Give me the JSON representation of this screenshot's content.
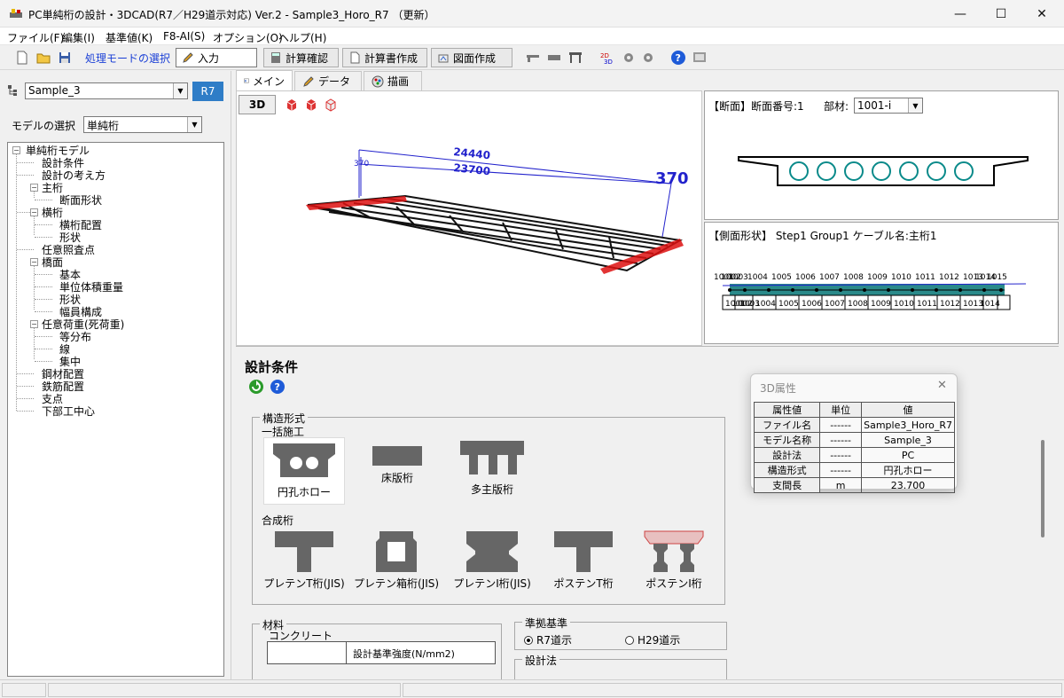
{
  "window": {
    "title": "PC単純桁の設計・3DCAD(R7／H29道示対応) Ver.2 - Sample3_Horo_R7 （更新）",
    "minimize": "—",
    "maximize": "☐",
    "close": "✕"
  },
  "menu": [
    "ファイル(F)",
    "編集(I)",
    "基準値(K)",
    "F8-AI(S)",
    "オプション(O)",
    "ヘルプ(H)"
  ],
  "toolbar": {
    "mode_label": "処理モードの選択",
    "buttons": [
      "入力",
      "計算確認",
      "計算書作成",
      "図面作成"
    ]
  },
  "left": {
    "file_combo": "Sample_3",
    "r7_button": "R7",
    "model_label": "モデルの選択",
    "model_combo": "単純桁",
    "tree": [
      {
        "label": "単純桁モデル",
        "level": 0,
        "expand": "−"
      },
      {
        "label": "設計条件",
        "level": 1
      },
      {
        "label": "設計の考え方",
        "level": 1
      },
      {
        "label": "主桁",
        "level": 1,
        "expand": "−"
      },
      {
        "label": "断面形状",
        "level": 2
      },
      {
        "label": "横桁",
        "level": 1,
        "expand": "−"
      },
      {
        "label": "横桁配置",
        "level": 2
      },
      {
        "label": "形状",
        "level": 2
      },
      {
        "label": "任意照査点",
        "level": 1
      },
      {
        "label": "橋面",
        "level": 1,
        "expand": "−"
      },
      {
        "label": "基本",
        "level": 2
      },
      {
        "label": "単位体積重量",
        "level": 2
      },
      {
        "label": "形状",
        "level": 2
      },
      {
        "label": "幅員構成",
        "level": 2
      },
      {
        "label": "任意荷重(死荷重)",
        "level": 1,
        "expand": "−"
      },
      {
        "label": "等分布",
        "level": 2
      },
      {
        "label": "線",
        "level": 2
      },
      {
        "label": "集中",
        "level": 2
      },
      {
        "label": "鋼材配置",
        "level": 1
      },
      {
        "label": "鉄筋配置",
        "level": 1
      },
      {
        "label": "支点",
        "level": 1
      },
      {
        "label": "下部工中心",
        "level": 1
      }
    ]
  },
  "tabs": [
    "メイン",
    "データ",
    "描画"
  ],
  "view3d": {
    "btn3d": "3D",
    "dims": {
      "top": "24440",
      "mid": "23700",
      "left": "370",
      "right": "370"
    }
  },
  "section": {
    "label": "【断面】断面番号:1",
    "member_label": "部材:",
    "member_value": "1001-i"
  },
  "side": {
    "label": "【側面形状】 Step1 Group1 ケーブル名:主桁1",
    "top_numbers": [
      "1001",
      "1002",
      "1003",
      "1004",
      "1005",
      "1006",
      "1007",
      "1008",
      "1009",
      "1010",
      "1011",
      "1012",
      "1013",
      "1014",
      "1015"
    ],
    "bottom_numbers": [
      "1001",
      "1002",
      "1003",
      "1004",
      "1005",
      "1006",
      "1007",
      "1008",
      "1009",
      "1010",
      "1011",
      "1012",
      "1013",
      "1014"
    ]
  },
  "design": {
    "heading": "設計条件",
    "structure_group": "構造形式",
    "bulk_label": "一括施工",
    "bulk_options": [
      "円孔ホロー",
      "床版桁",
      "多主版桁"
    ],
    "composite_label": "合成桁",
    "composite_options": [
      "プレテンT桁(JIS)",
      "プレテン箱桁(JIS)",
      "プレテンI桁(JIS)",
      "ポステンT桁",
      "ポステンI桁"
    ],
    "material_group": "材料",
    "concrete_label": "コンクリート",
    "strength_header": "設計基準強度(N/mm2)",
    "standard_group": "準拠基準",
    "standard_r7": "R7道示",
    "standard_h29": "H29道示",
    "method_group": "設計法"
  },
  "dialog": {
    "title": "3D属性",
    "close": "✕",
    "headers": [
      "属性値",
      "単位",
      "値"
    ],
    "rows": [
      [
        "ファイル名",
        "------",
        "Sample3_Horo_R7"
      ],
      [
        "モデル名称",
        "------",
        "Sample_3"
      ],
      [
        "設計法",
        "------",
        "PC"
      ],
      [
        "構造形式",
        "------",
        "円孔ホロー"
      ],
      [
        "支間長",
        "m",
        "23.700"
      ]
    ]
  }
}
